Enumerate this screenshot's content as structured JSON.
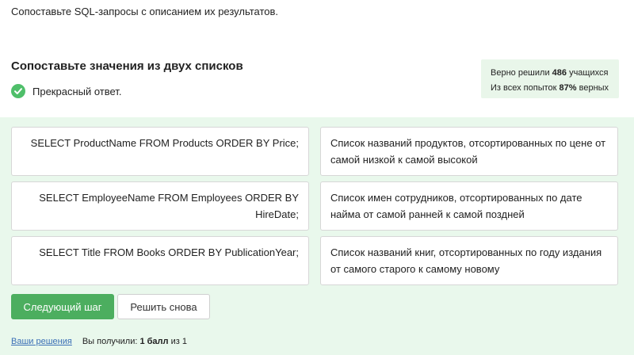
{
  "prompt": "Сопоставьте SQL-запросы с описанием их результатов.",
  "task_title": "Сопоставьте значения из двух списков",
  "feedback": {
    "text": "Прекрасный ответ."
  },
  "stats": {
    "line1_prefix": "Верно решили",
    "solved_count": "486",
    "line1_suffix": "учащихся",
    "line2_prefix": "Из всех попыток",
    "percent": "87%",
    "line2_suffix": "верных"
  },
  "pairs": [
    {
      "query": "SELECT ProductName FROM Products ORDER BY Price;",
      "description": "Список названий продуктов, отсортированных по цене от самой низкой к самой высокой"
    },
    {
      "query": "SELECT EmployeeName FROM Employees ORDER BY HireDate;",
      "description": "Список имен сотрудников, отсортированных по дате найма от самой ранней к самой поздней"
    },
    {
      "query": "SELECT Title FROM Books ORDER BY PublicationYear;",
      "description": "Список названий книг, отсортированных по году издания от самого старого к самому новому"
    }
  ],
  "buttons": {
    "next": "Следующий шаг",
    "retry": "Решить снова"
  },
  "footer": {
    "solutions_link": "Ваши решения",
    "score_prefix": "Вы получили:",
    "score_value": "1 балл",
    "score_suffix": "из 1"
  },
  "colors": {
    "accent": "#4cae5f",
    "panel_bg": "#e9f8ec",
    "link": "#3b6fb6"
  }
}
